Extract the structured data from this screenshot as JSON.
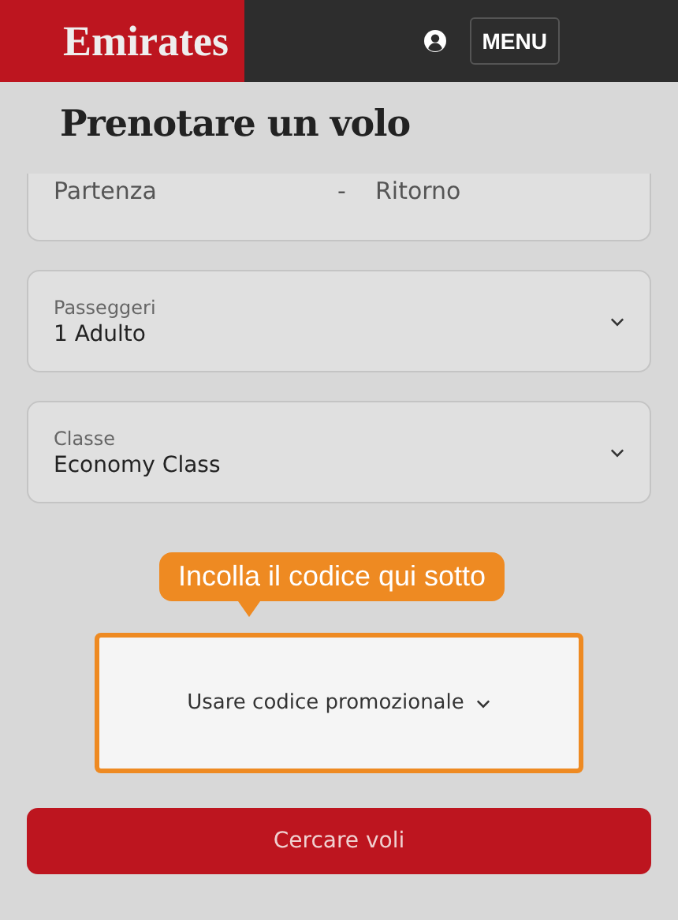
{
  "header": {
    "logo": "Emirates",
    "menu_button": "MENU"
  },
  "title": "Prenotare un volo",
  "dates": {
    "departure": "Partenza",
    "separator": "-",
    "return": "Ritorno"
  },
  "selects": [
    {
      "label": "Passeggeri",
      "value": "1 Adulto"
    },
    {
      "label": "Classe",
      "value": "Economy Class"
    }
  ],
  "callout": "Incolla il codice qui sotto",
  "promo_link": "Usare codice promozionale",
  "search_button": "Cercare voli"
}
